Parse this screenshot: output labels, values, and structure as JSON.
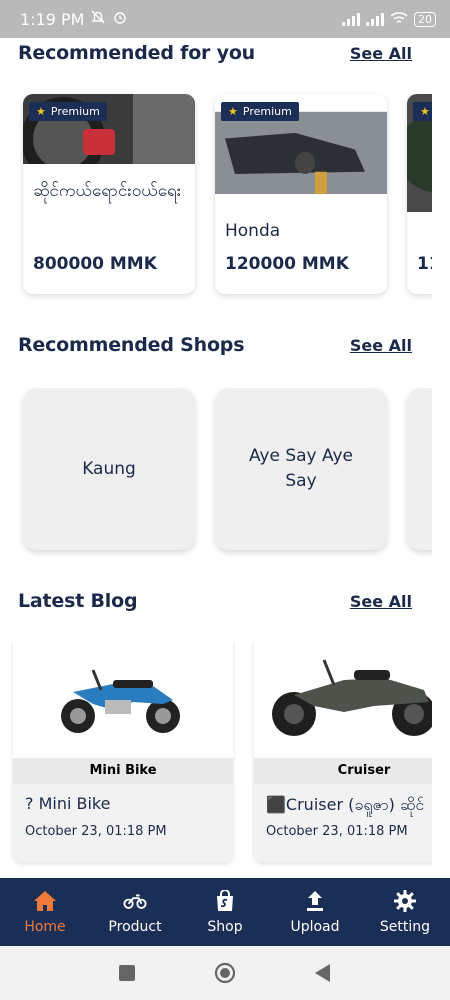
{
  "status": {
    "time": "1:19 PM",
    "battery": "20"
  },
  "recommended": {
    "title": "Recommended for you",
    "see_all": "See All",
    "premium_label": "Premium",
    "items": [
      {
        "title": "ဆိုင်ကယ်ရောင်းဝယ်ရေး",
        "price": "800000 MMK"
      },
      {
        "title": "Honda",
        "price": "120000 MMK"
      },
      {
        "title": "",
        "price": "11("
      }
    ]
  },
  "shops": {
    "title": "Recommended Shops",
    "see_all": "See All",
    "items": [
      {
        "name": "Kaung"
      },
      {
        "name": "Aye Say Aye Say"
      }
    ]
  },
  "blog": {
    "title": "Latest Blog",
    "see_all": "See All",
    "items": [
      {
        "caption": "Mini Bike",
        "title": "? Mini Bike",
        "date": "October 23, 01:18 PM"
      },
      {
        "caption": "Cruiser",
        "title": "⬛Cruiser (ခရူဇာ) ဆိုင်",
        "date": "October 23, 01:18 PM"
      }
    ]
  },
  "nav": {
    "items": [
      {
        "label": "Home",
        "icon": "home-icon",
        "active": true
      },
      {
        "label": "Product",
        "icon": "motorbike-icon",
        "active": false
      },
      {
        "label": "Shop",
        "icon": "shopping-bag-icon",
        "active": false
      },
      {
        "label": "Upload",
        "icon": "upload-icon",
        "active": false
      },
      {
        "label": "Setting",
        "icon": "gear-icon",
        "active": false
      }
    ]
  },
  "colors": {
    "navy": "#1b2e55",
    "accent": "#f07a3a",
    "star": "#f5c518"
  }
}
